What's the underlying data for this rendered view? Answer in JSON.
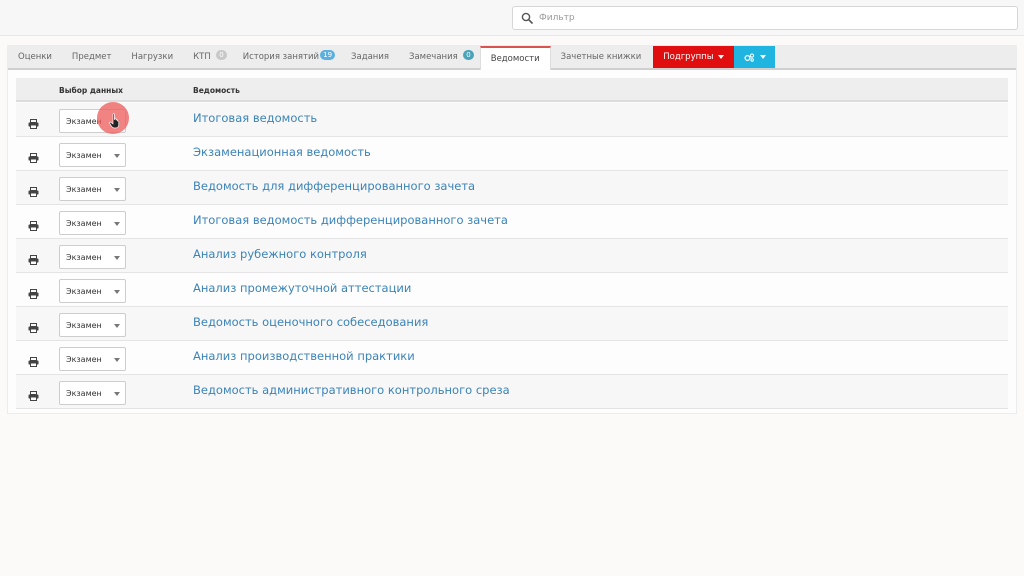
{
  "filter": {
    "placeholder": "Фильтр",
    "value": ""
  },
  "tabs": [
    {
      "label": "Оценки"
    },
    {
      "label": "Предмет"
    },
    {
      "label": "Нагрузки"
    },
    {
      "label": "КТП",
      "badge": "0",
      "badge_color": "#c8c8c8"
    },
    {
      "label": "История занятий",
      "badge": "19",
      "badge_color": "#5ab0e0"
    },
    {
      "label": "Задания"
    },
    {
      "label": "Замечания",
      "badge": "0",
      "badge_color": "#4aa3b8"
    },
    {
      "label": "Ведомости",
      "active": true
    },
    {
      "label": "Зачетные книжки"
    }
  ],
  "subgroups_button": {
    "label": "Подгруппы",
    "color": "#e00e0e"
  },
  "settings_button": {
    "icon": "cogs-icon",
    "color": "#1fb5e0"
  },
  "table": {
    "headers": {
      "data_select": "Выбор данных",
      "statement": "Ведомость"
    },
    "rows": [
      {
        "select_value": "Экзамен",
        "title": "Итоговая ведомость"
      },
      {
        "select_value": "Экзамен",
        "title": "Экзаменационная ведомость"
      },
      {
        "select_value": "Экзамен",
        "title": "Ведомость для дифференцированного зачета"
      },
      {
        "select_value": "Экзамен",
        "title": "Итоговая ведомость дифференцированного зачета"
      },
      {
        "select_value": "Экзамен",
        "title": "Анализ рубежного контроля"
      },
      {
        "select_value": "Экзамен",
        "title": "Анализ промежуточной аттестации"
      },
      {
        "select_value": "Экзамен",
        "title": "Ведомость оценочного собеседования"
      },
      {
        "select_value": "Экзамен",
        "title": "Анализ производственной практики"
      },
      {
        "select_value": "Экзамен",
        "title": "Ведомость административного контрольного среза"
      }
    ]
  },
  "colors": {
    "link": "#3b83b8",
    "active_tab_accent": "#d9534f",
    "cursor_highlight": "#ee6060"
  }
}
